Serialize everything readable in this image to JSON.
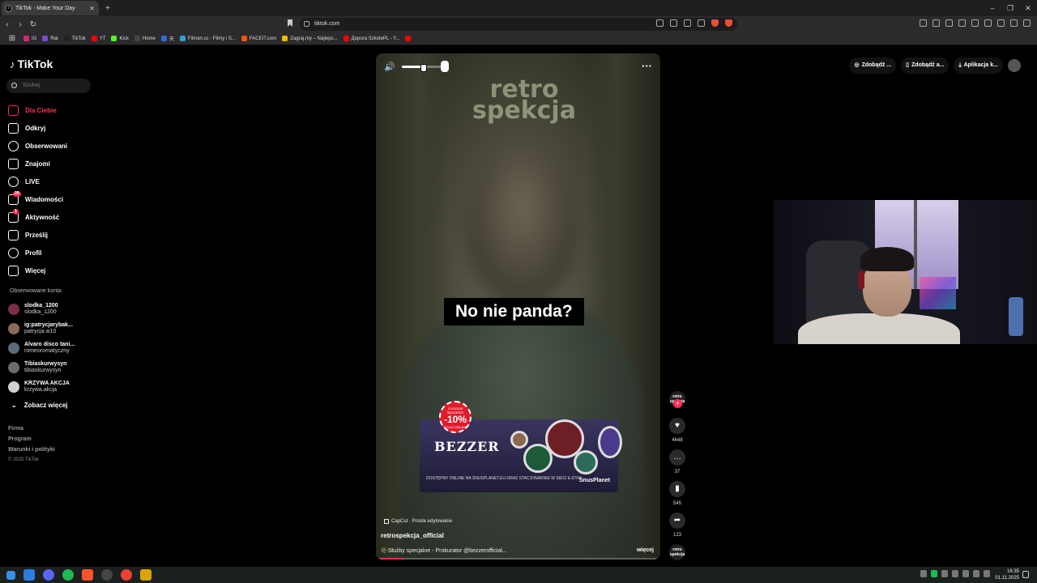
{
  "browser": {
    "tab_title": "TikTok - Make Your Day",
    "url": "tiktok.com",
    "bookmarks": [
      {
        "label": "IG",
        "color": "#d62976"
      },
      {
        "label": "Rat",
        "color": "#7b4ad6"
      },
      {
        "label": "TikTok",
        "color": "#222222"
      },
      {
        "label": "YT",
        "color": "#ff0000"
      },
      {
        "label": "Kick",
        "color": "#53fc18"
      },
      {
        "label": "Home",
        "color": "#444444"
      },
      {
        "label": "天",
        "color": "#2d6cdf"
      },
      {
        "label": "Filman.cc - Filmy i S...",
        "color": "#2ea3d6"
      },
      {
        "label": "FACEIT.com",
        "color": "#ff5500"
      },
      {
        "label": "Zagraj.my – Najleps...",
        "color": "#f5b900"
      },
      {
        "label": "Дорога SzkolePL - Y...",
        "color": "#ff0000"
      },
      {
        "label": "",
        "color": "#ff0000"
      }
    ]
  },
  "sidebar": {
    "logo": "TikTok",
    "search_placeholder": "Szukaj",
    "nav": [
      {
        "label": "Dla Ciebie",
        "active": true,
        "icon": "home-icon"
      },
      {
        "label": "Odkryj",
        "icon": "compass-icon"
      },
      {
        "label": "Obserwowani",
        "icon": "following-icon"
      },
      {
        "label": "Znajomi",
        "icon": "friends-icon"
      },
      {
        "label": "LIVE",
        "icon": "live-icon"
      },
      {
        "label": "Wiadomości",
        "icon": "messages-icon",
        "badge": "26"
      },
      {
        "label": "Aktywność",
        "icon": "activity-icon",
        "badge": "1"
      },
      {
        "label": "Prześlij",
        "icon": "upload-icon"
      },
      {
        "label": "Profil",
        "icon": "profile-icon"
      },
      {
        "label": "Więcej",
        "icon": "more-icon"
      }
    ],
    "followed_title": "Obserwowane konta",
    "followed": [
      {
        "name": "slodka_1200",
        "handle": "slodka_1200"
      },
      {
        "name": "ig:patrycjarybak...",
        "handle": "patrycja.w10"
      },
      {
        "name": "Alvaro disco tani...",
        "handle": "romeoromatyczny"
      },
      {
        "name": "Tibiaskurwysyn",
        "handle": "tibiaskurwysyn"
      },
      {
        "name": "KRZYWA AKCJA",
        "handle": "krzywa.akcja"
      }
    ],
    "see_more": "Zobacz więcej",
    "footer": [
      "Firma",
      "Program",
      "Warunki i polityki"
    ],
    "copyright": "© 2025 TikTok"
  },
  "video": {
    "watermark": "retro spekcja",
    "caption": "No nie panda?",
    "volume_level": 0.55,
    "progress": 0.09,
    "ad": {
      "brand": "BEZZER",
      "promo_top": "Z KODEM \"BEZZERO\"",
      "promo_discount": "-10%",
      "promo_bottom": "TYLKO ONLINE",
      "footer": "DOSTĘPNY ONLINE NA SNUSPLANET.EU ORAZ STACJONARNIE W SIECI E-DYM",
      "partner": "SnusPlanet"
    },
    "capcut": "CapCut · Proste edytowanie",
    "author": "retrospekcja_official",
    "description": "🪖Służby specjalne - Prokurator @bezzerofficial...",
    "more": "więcej"
  },
  "actions": {
    "avatar_text": "retro spekcja",
    "likes": "4648",
    "comments": "37",
    "saves": "545",
    "shares": "123"
  },
  "top_right": {
    "buttons": [
      "Zdobądź ...",
      "Zdobądź a...",
      "Aplikacja k..."
    ]
  },
  "taskbar": {
    "time": "16:35",
    "date": "01.11.2025"
  }
}
